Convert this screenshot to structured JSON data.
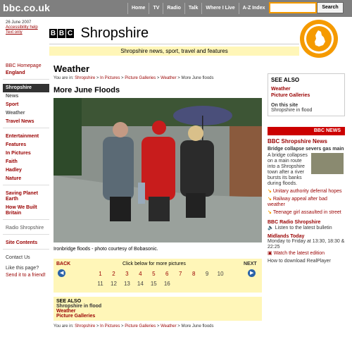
{
  "header": {
    "site": "bbc.co.uk",
    "nav": [
      "Home",
      "TV",
      "Radio",
      "Talk",
      "Where I Live",
      "A-Z Index"
    ],
    "search_button": "Search"
  },
  "top_left": {
    "date": "26 June 2007",
    "accessibility": "Accessibility help",
    "text_only": "Text only"
  },
  "banner": {
    "letters": [
      "B",
      "B",
      "C"
    ],
    "title": "Shropshire",
    "tagline": "Shropshire news, sport, travel and features"
  },
  "leftnav": {
    "home": "BBC Homepage",
    "england": "England",
    "active": "Shropshire",
    "items": [
      "News",
      "Sport",
      "Weather",
      "Travel News"
    ],
    "items2": [
      "Entertainment",
      "Features",
      "In Pictures",
      "Faith",
      "Hadley",
      "Nature"
    ],
    "items3": [
      "Saving Planet Earth",
      "How We Built Britain"
    ],
    "radio": "Radio Shropshire",
    "site_contents": "Site Contents",
    "contact": "Contact Us",
    "like": "Like this page?",
    "send": "Send it to a friend!"
  },
  "content": {
    "section_title": "Weather",
    "breadcrumb": {
      "prefix": "You are in:",
      "items": [
        "Shropshire",
        "In Pictures",
        "Picture Galleries",
        "Weather"
      ],
      "current": "More June floods"
    },
    "page_title": "More June Floods",
    "caption": "Ironbridge floods - photo courtesy of Bobasonic.",
    "gallery": {
      "back": "BACK",
      "next": "NEXT",
      "hint": "Click below for more pictures",
      "pages": [
        "1",
        "2",
        "3",
        "4",
        "5",
        "6",
        "7",
        "8",
        "9",
        "10",
        "11",
        "12",
        "13",
        "14",
        "15",
        "16"
      ]
    },
    "see_also": {
      "heading": "SEE ALSO",
      "line1": "Shropshire in flood",
      "line2": "Weather",
      "line3": "Picture Galleries"
    }
  },
  "right": {
    "see_also_heading": "SEE ALSO",
    "see_also_links": [
      "Weather",
      "Picture Galleries"
    ],
    "on_this_site": "On this site",
    "on_this_link": "Shropshire in flood",
    "news_header": "BBC NEWS",
    "news_title": "BBC Shropshire News",
    "news_lead": "Bridge collapse severs gas main",
    "news_text": "A bridge collapses on a main route into a Shropshire town after a river bursts its banks during floods.",
    "bullets": [
      "Unitary authority deferral hopes",
      "Railway appeal after bad weather",
      "Teenage girl assaulted in street"
    ],
    "radio_title": "BBC Radio Shropshire",
    "radio_listen": "Listen to the latest bulletin",
    "midlands_title": "Midlands Today",
    "midlands_text": "Monday to Friday at 13:30, 18:30 & 22:25",
    "midlands_watch": "Watch the latest edition",
    "download": "How to download RealPlayer"
  },
  "colors": {
    "brand_red": "#990000",
    "accent_orange": "#f59a00",
    "highlight_yellow": "#fff6b8"
  }
}
